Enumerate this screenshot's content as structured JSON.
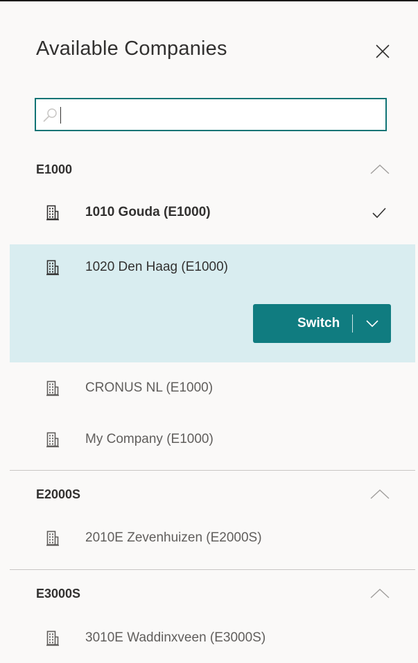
{
  "panel": {
    "title": "Available Companies",
    "close_icon": "close-icon"
  },
  "search": {
    "value": "",
    "placeholder": "",
    "icon": "search-icon"
  },
  "groups": [
    {
      "name": "E1000",
      "icon": "chevron-up-icon",
      "items": [
        {
          "label": "1010 Gouda (E1000)",
          "current": true,
          "icon": "building-icon"
        },
        {
          "label": "1020 Den Haag (E1000)",
          "selected": true,
          "icon": "building-icon"
        },
        {
          "label": "CRONUS NL (E1000)",
          "icon": "building-icon"
        },
        {
          "label": "My Company (E1000)",
          "icon": "building-icon"
        }
      ]
    },
    {
      "name": "E2000S",
      "icon": "chevron-up-icon",
      "items": [
        {
          "label": "2010E Zevenhuizen (E2000S)",
          "icon": "building-icon"
        }
      ]
    },
    {
      "name": "E3000S",
      "icon": "chevron-up-icon",
      "items": [
        {
          "label": "3010E Waddinxveen (E3000S)",
          "icon": "building-icon"
        }
      ]
    }
  ],
  "switch_button": {
    "label": "Switch",
    "dropdown_icon": "chevron-down-icon"
  },
  "colors": {
    "accent": "#107c80",
    "selected_background": "#d9edf0",
    "panel_background": "#faf9f8"
  }
}
